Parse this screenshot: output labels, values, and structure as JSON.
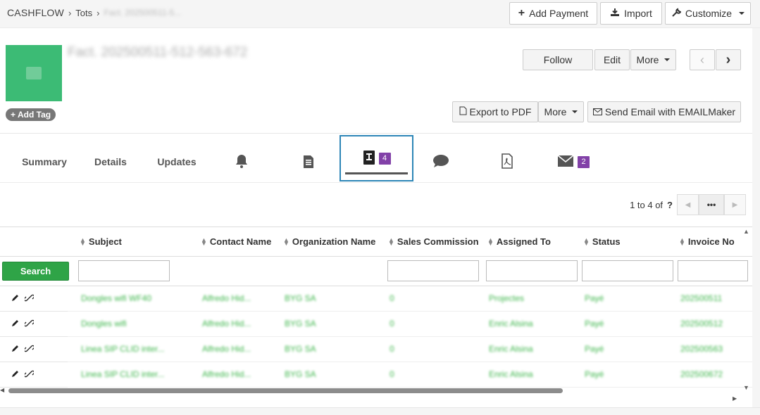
{
  "breadcrumb": {
    "app": "CASHFLOW",
    "module": "Tots",
    "record": "Fact. 202500511-5..."
  },
  "toolbar": {
    "add_payment": "Add Payment",
    "import": "Import",
    "customize": "Customize"
  },
  "record": {
    "title": "Fact. 202500511-512-563-672",
    "add_tag": "Add Tag"
  },
  "actions": {
    "follow": "Follow",
    "edit": "Edit",
    "more": "More",
    "export_pdf": "Export to PDF",
    "more2": "More",
    "send_email": "Send Email with EMAILMaker"
  },
  "tabs": [
    {
      "label": "Summary"
    },
    {
      "label": "Details"
    },
    {
      "label": "Updates"
    },
    {
      "icon": "bell-icon"
    },
    {
      "icon": "document-icon"
    },
    {
      "icon": "invoice-icon",
      "badge": "4"
    },
    {
      "icon": "comment-icon"
    },
    {
      "icon": "pdf-file-icon"
    },
    {
      "icon": "email-icon",
      "badge": "2"
    }
  ],
  "pager": {
    "text": "1 to 4  of",
    "total": "?",
    "more": "•••"
  },
  "table": {
    "columns": [
      "Subject",
      "Contact Name",
      "Organization Name",
      "Sales Commission",
      "Assigned To",
      "Status",
      "Invoice No"
    ],
    "search_label": "Search",
    "rows": [
      [
        "Dongles wifi WF40",
        "Alfredo Hid...",
        "BYG SA",
        "0",
        "Projectes",
        "Payé",
        "202500511"
      ],
      [
        "Dongles wifi",
        "Alfredo Hid...",
        "BYG SA",
        "0",
        "Enric Alsina",
        "Payé",
        "202500512"
      ],
      [
        "Linea SIP CLID inter...",
        "Alfredo Hid...",
        "BYG SA",
        "0",
        "Enric Alsina",
        "Payé",
        "202500563"
      ],
      [
        "Linea SIP CLID inter...",
        "Alfredo Hid...",
        "BYG SA",
        "0",
        "Enric Alsina",
        "Payé",
        "202500672"
      ]
    ]
  },
  "colors": {
    "accent_green": "#3cbb75",
    "search_green": "#2fa447",
    "badge_purple": "#8241a8",
    "active_tab_border": "#2d86b7"
  }
}
